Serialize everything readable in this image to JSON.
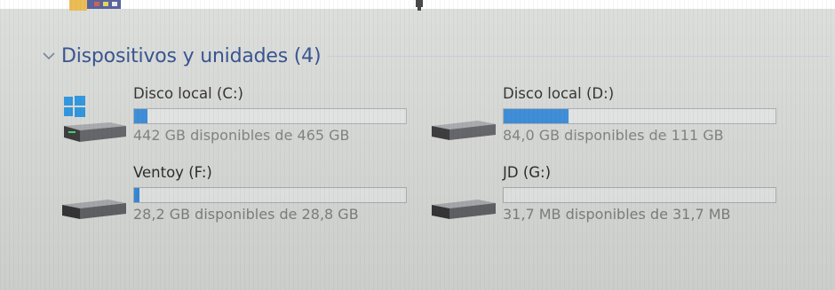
{
  "group": {
    "title": "Dispositivos y unidades (4)",
    "chevron_icon": "chevron-down-icon"
  },
  "drives": [
    {
      "label": "Disco local (C:)",
      "info": "442 GB disponibles de 465 GB",
      "used_fraction": 0.05,
      "icon": "windows-drive-icon"
    },
    {
      "label": "Disco local (D:)",
      "info": "84,0 GB disponibles de 111 GB",
      "used_fraction": 0.24,
      "icon": "drive-icon"
    },
    {
      "label": "Ventoy (F:)",
      "info": "28,2 GB disponibles de 28,8 GB",
      "used_fraction": 0.02,
      "icon": "drive-icon"
    },
    {
      "label": "JD (G:)",
      "info": "31,7 MB disponibles de 31,7 MB",
      "used_fraction": 0.0,
      "icon": "drive-icon"
    }
  ],
  "colors": {
    "bar_fill": "#2d86d8",
    "bar_track": "#e3e4e4",
    "header_text": "#1f3f83",
    "info_text": "#7a7b7d"
  }
}
